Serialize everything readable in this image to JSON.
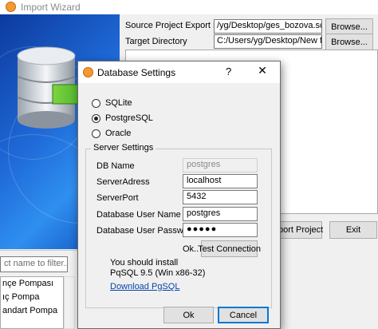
{
  "background_window": {
    "title": "Import Wizard",
    "source_label": "Source Project Export File",
    "source_value": "/yg/Desktop/ges_bozova.scaexp",
    "target_label": "Target Directory",
    "target_value": "C:/Users/yg/Desktop/New folder",
    "browse_label": "Browse...",
    "import_button": "Import Project",
    "exit_button": "Exit",
    "filter_placeholder": "ct name to filter...",
    "list_items": [
      "nçe Pompası",
      "ıç Pompa",
      "andart Pompa"
    ]
  },
  "dialog": {
    "title": "Database Settings",
    "help": "?",
    "close": "✕",
    "db_options": [
      {
        "label": "SQLite",
        "selected": false
      },
      {
        "label": "PostgreSQL",
        "selected": true
      },
      {
        "label": "Oracle",
        "selected": false
      }
    ],
    "server_settings": {
      "legend": "Server Settings",
      "db_name_label": "DB Name",
      "db_name_value": "postgres",
      "address_label": "ServerAdress",
      "address_value": "localhost",
      "port_label": "ServerPort",
      "port_value": "5432",
      "user_label": "Database User Name",
      "user_value": "postgres",
      "password_label": "Database User Password",
      "password_value": "●●●●●",
      "status_text": "Ok..",
      "test_button": "Test Connection",
      "install_line1": "You should install",
      "install_line2": "PqSQL 9.5 (Win x86-32)",
      "download_link": "Download PgSQL"
    },
    "ok_button": "Ok",
    "cancel_button": "Cancel"
  }
}
